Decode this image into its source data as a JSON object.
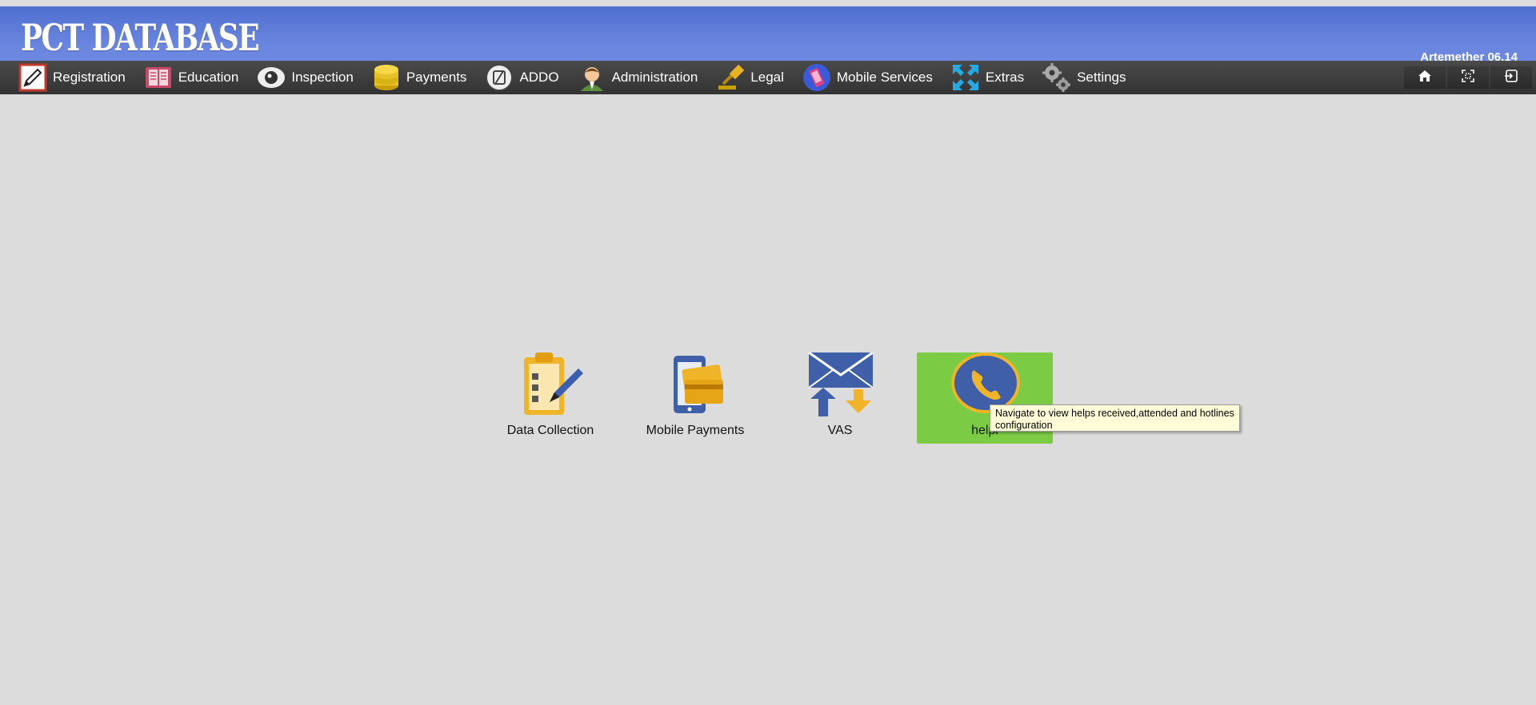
{
  "header": {
    "brand": "PCT DATABASE",
    "user_label": "Artemether 06.14",
    "background": "#6a86df"
  },
  "menu": [
    {
      "label": "Registration",
      "icon": "pencil-icon"
    },
    {
      "label": "Education",
      "icon": "book-icon"
    },
    {
      "label": "Inspection",
      "icon": "eye-icon"
    },
    {
      "label": "Payments",
      "icon": "coins-icon"
    },
    {
      "label": "ADDO",
      "icon": "addo-icon"
    },
    {
      "label": "Administration",
      "icon": "user-icon"
    },
    {
      "label": "Legal",
      "icon": "gavel-icon"
    },
    {
      "label": "Mobile Services",
      "icon": "mobile-icon"
    },
    {
      "label": "Extras",
      "icon": "expand-arrows-icon"
    },
    {
      "label": "Settings",
      "icon": "gears-icon"
    }
  ],
  "toolbar": {
    "home_icon": "home-icon",
    "fullscreen_icon": "fullscreen-icon",
    "logout_icon": "logout-icon"
  },
  "tiles": [
    {
      "label": "Data Collection",
      "icon": "clipboard-icon"
    },
    {
      "label": "Mobile Payments",
      "icon": "mobile-payment-icon"
    },
    {
      "label": "VAS",
      "icon": "envelope-transfer-icon"
    },
    {
      "label": "helpl",
      "icon": "phone-icon",
      "active": true
    }
  ],
  "tooltip": {
    "text": "Navigate to view helps received,attended and hotlines configuration"
  },
  "colors": {
    "active_tile": "#7ccb45",
    "menubar": "#3a3a3a",
    "page_background": "#dcdcdc"
  }
}
